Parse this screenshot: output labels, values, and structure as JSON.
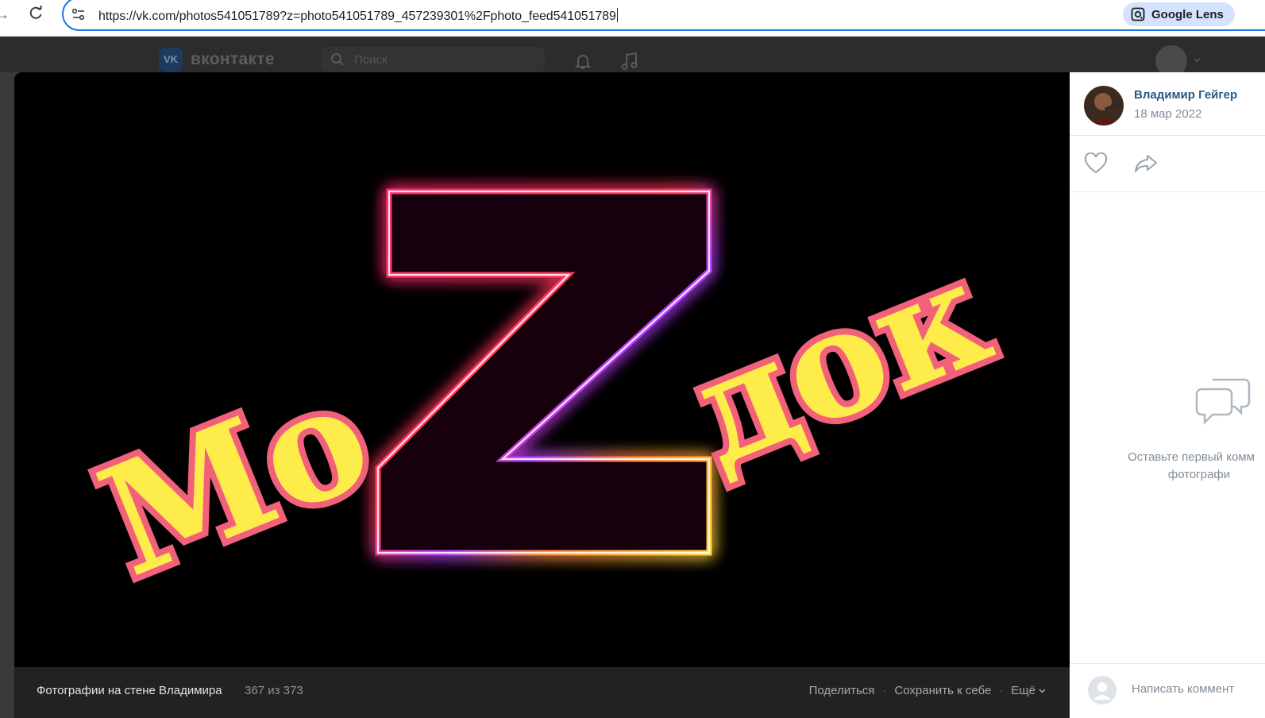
{
  "browser": {
    "url": "https://vk.com/photos541051789?z=photo541051789_457239301%2Fphoto_feed541051789",
    "lens_label": "Google Lens"
  },
  "vk": {
    "brand": "вконтакте",
    "logo_text": "VK",
    "search_placeholder": "Поиск"
  },
  "photo": {
    "text_left": "Мо",
    "text_center": "Z",
    "text_right": "док"
  },
  "viewer_bar": {
    "album_title": "Фотографии на стене Владимира",
    "count": "367 из 373",
    "share": "Поделиться",
    "save": "Сохранить к себе",
    "more": "Ещё",
    "dot": "·"
  },
  "side": {
    "author": "Владимир Гейгер",
    "date": "18 мар 2022",
    "empty_line1": "Оставьте первый комм",
    "empty_line2": "фотографи",
    "comment_placeholder": "Написать коммент"
  },
  "colors": {
    "vk_link": "#2a5885",
    "lens_chip": "#d3e3fd",
    "omnibox_focus": "#1a73e8"
  }
}
